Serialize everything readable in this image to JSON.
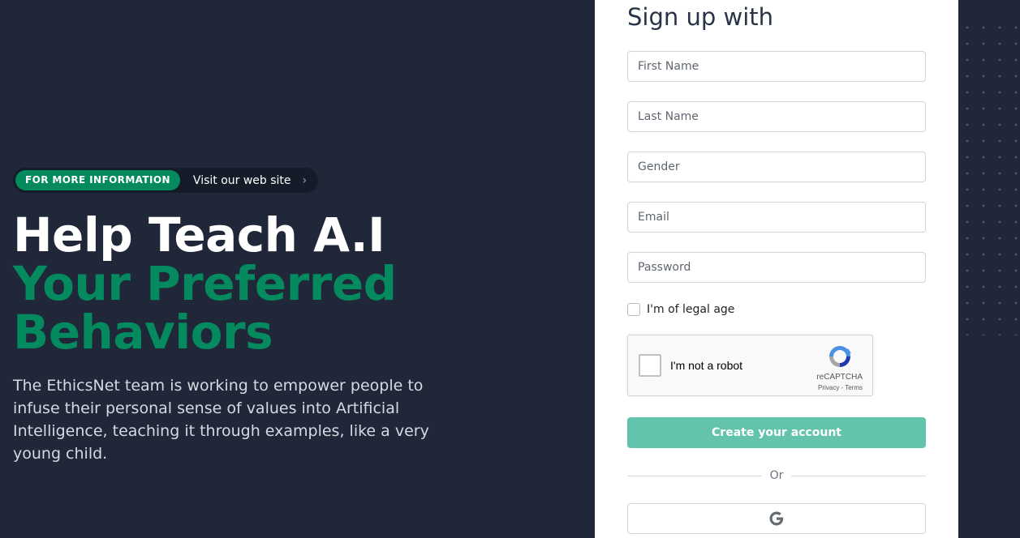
{
  "hero": {
    "badge": "FOR MORE INFORMATION",
    "link_text": "Visit our web site",
    "chevron": "›",
    "headline_line1": "Help Teach A.I",
    "headline_line2": "Your Preferred",
    "headline_line3": "Behaviors",
    "description": "The EthicsNet team is working to empower people to infuse their personal sense of values into Artificial Intelligence, teaching it through examples, like a very young child."
  },
  "form": {
    "title": "Sign up with",
    "first_name_placeholder": "First Name",
    "last_name_placeholder": "Last Name",
    "gender_placeholder": "Gender",
    "email_placeholder": "Email",
    "password_placeholder": "Password",
    "legal_age_label": "I'm of legal age",
    "submit_label": "Create your account",
    "divider_text": "Or",
    "google_icon": "google-icon"
  },
  "recaptcha": {
    "label": "I'm not a robot",
    "brand": "reCAPTCHA",
    "links": "Privacy - Terms"
  },
  "colors": {
    "background": "#1f2738",
    "accent_green": "#048a5e",
    "button_green": "#64c3ac",
    "panel": "#ffffff"
  }
}
